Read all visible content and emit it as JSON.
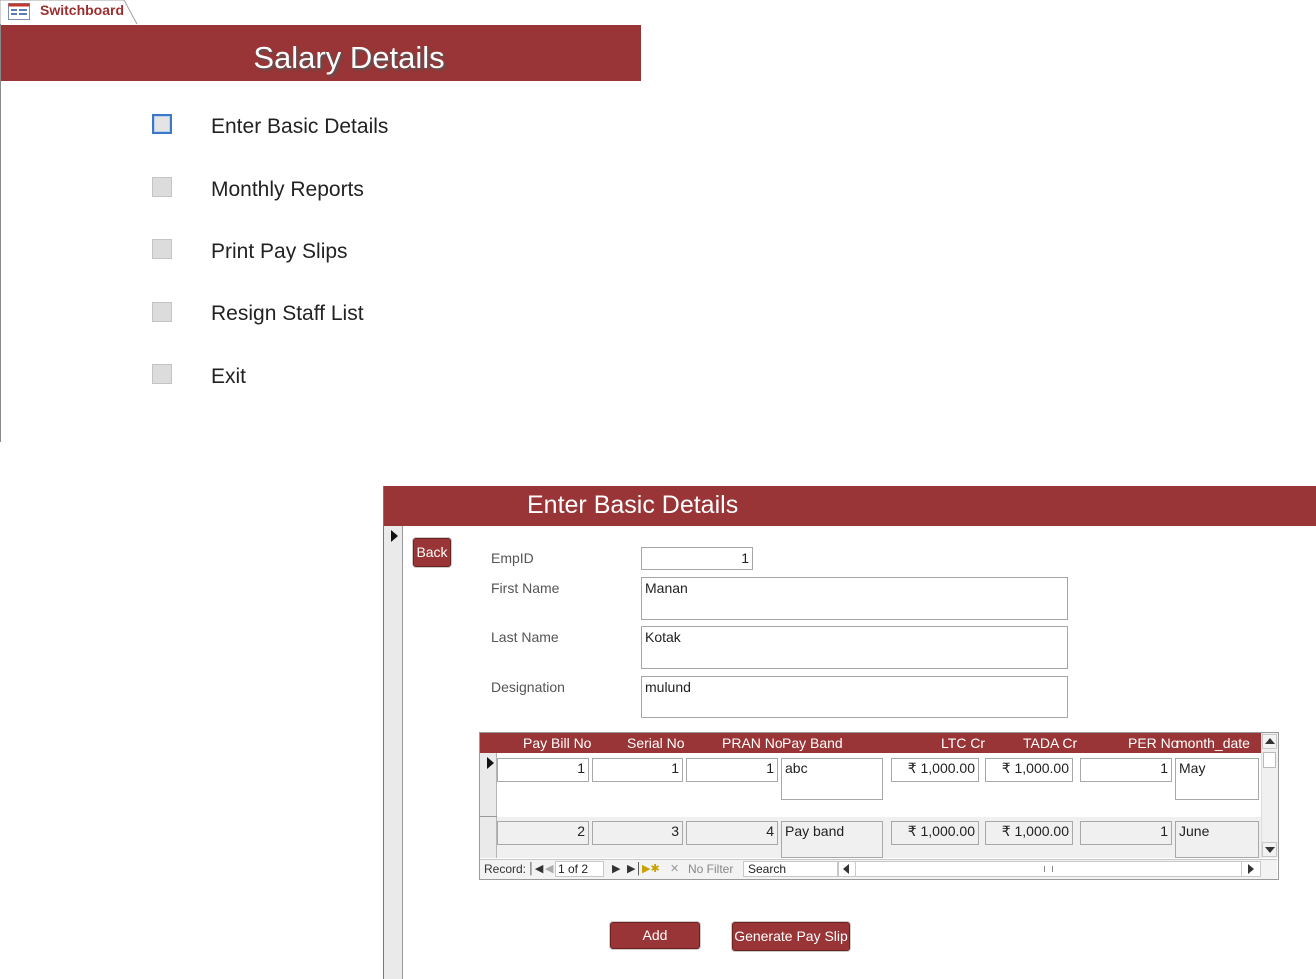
{
  "switchboard": {
    "tab_label": "Switchboard",
    "tab_icon": "form-icon",
    "title": "Salary Details",
    "items": [
      {
        "label": "Enter Basic Details"
      },
      {
        "label": "Monthly Reports"
      },
      {
        "label": "Print Pay Slips"
      },
      {
        "label": "Resign Staff List"
      },
      {
        "label": "Exit"
      }
    ]
  },
  "basic_details": {
    "title": "Enter Basic Details",
    "back_label": "Back",
    "fields": {
      "empid": {
        "label": "EmpID",
        "value": "1"
      },
      "first_name": {
        "label": "First Name",
        "value": "Manan"
      },
      "last_name": {
        "label": "Last Name",
        "value": "Kotak"
      },
      "designation": {
        "label": "Designation",
        "value": "mulund"
      }
    },
    "subform": {
      "columns": [
        "Pay Bill No",
        "Serial No",
        "PRAN No",
        "Pay Band",
        "LTC Cr",
        "TADA Cr",
        "PER No",
        "month_date"
      ],
      "rows": [
        [
          "1",
          "1",
          "1",
          "abc",
          "₹ 1,000.00",
          "₹ 1,000.00",
          "1",
          "May"
        ],
        [
          "2",
          "3",
          "4",
          "Pay band",
          "₹ 1,000.00",
          "₹ 1,000.00",
          "1",
          "June"
        ]
      ],
      "nav": {
        "record_label": "Record:",
        "record_value": "1 of 2",
        "filter_label": "No Filter",
        "search_placeholder": "Search"
      }
    },
    "add_label": "Add",
    "generate_label": "Generate Pay Slip"
  },
  "colors": {
    "header_maroon": "#993536",
    "focus_blue": "#3b78c8",
    "tab_text": "#9b2f2f"
  }
}
